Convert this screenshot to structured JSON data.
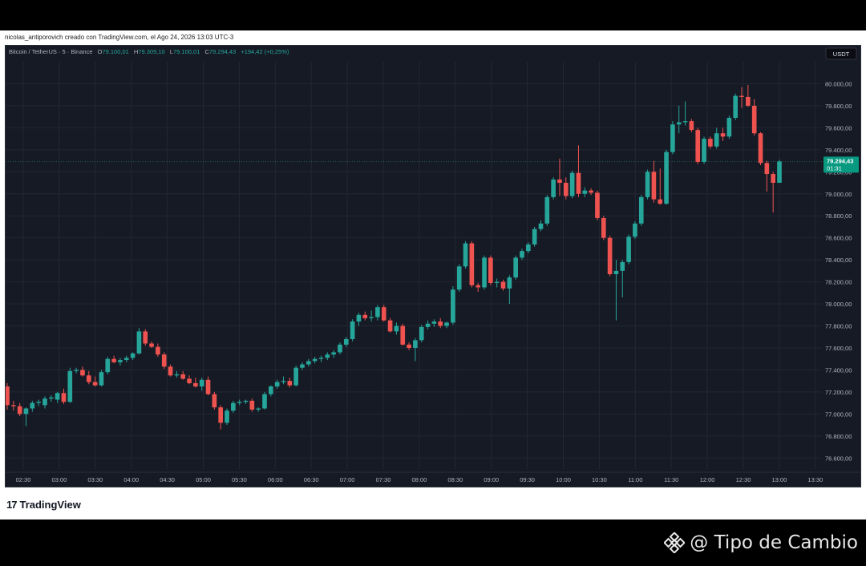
{
  "credit": "nicolas_antiporovich creado con TradingView.com, el Ago 24, 2026 13:03 UTC-3",
  "legend": {
    "symbol": "Bitcoin / TetherUS · 5 · Binance",
    "o_label": "O",
    "o_value": "79.100,01",
    "h_label": "H",
    "h_value": "79.309,10",
    "l_label": "L",
    "l_value": "79.100,01",
    "c_label": "C",
    "c_value": "79.294,43",
    "change": "+194,42 (+0,25%)"
  },
  "currency": "USDT",
  "price_tag": {
    "value": "79.294,43",
    "countdown": "01:31"
  },
  "brand": {
    "logo": "17",
    "name": "TradingView"
  },
  "watermark": {
    "icon": "binance-diamond-icon",
    "text": "@ Tipo de Cambio"
  },
  "colors": {
    "up": "#26a69a",
    "down": "#ef5350",
    "background": "#161a25",
    "grid": "#232733",
    "text": "#b2b5be"
  },
  "chart_data": {
    "type": "candlestick",
    "symbol": "Bitcoin / TetherUS",
    "interval": "5",
    "exchange": "Binance",
    "currency": "USDT",
    "ylim": [
      76500,
      80200
    ],
    "yticks": [
      76600,
      76800,
      77000,
      77200,
      77400,
      77600,
      77800,
      78000,
      78200,
      78400,
      78600,
      78800,
      79000,
      79200,
      79400,
      79600,
      79800,
      80000
    ],
    "ytick_labels": [
      "76.600,00",
      "76.800,00",
      "77.000,00",
      "77.200,00",
      "77.400,00",
      "77.600,00",
      "77.800,00",
      "78.000,00",
      "78.200,00",
      "78.400,00",
      "78.600,00",
      "78.800,00",
      "79.000,00",
      "79.200,00",
      "79.400,00",
      "79.600,00",
      "79.800,00",
      "80.000,00"
    ],
    "xtick_labels": [
      "02:30",
      "03:00",
      "03:30",
      "04:00",
      "04:30",
      "05:00",
      "05:30",
      "06:00",
      "06:30",
      "07:00",
      "07:30",
      "08:00",
      "08:30",
      "09:00",
      "09:30",
      "10:00",
      "10:30",
      "11:00",
      "11:30",
      "12:00",
      "12:30",
      "13:00",
      "13:30"
    ],
    "last_price": 79294.43,
    "candles": [
      {
        "o": 77250,
        "h": 77280,
        "l": 77040,
        "c": 77080
      },
      {
        "o": 77080,
        "h": 77120,
        "l": 77030,
        "c": 77070
      },
      {
        "o": 77070,
        "h": 77100,
        "l": 76980,
        "c": 77000
      },
      {
        "o": 77000,
        "h": 77060,
        "l": 76890,
        "c": 77050
      },
      {
        "o": 77050,
        "h": 77120,
        "l": 77020,
        "c": 77100
      },
      {
        "o": 77100,
        "h": 77130,
        "l": 77070,
        "c": 77110
      },
      {
        "o": 77080,
        "h": 77160,
        "l": 77050,
        "c": 77140
      },
      {
        "o": 77140,
        "h": 77170,
        "l": 77110,
        "c": 77150
      },
      {
        "o": 77130,
        "h": 77200,
        "l": 77100,
        "c": 77190
      },
      {
        "o": 77190,
        "h": 77230,
        "l": 77090,
        "c": 77110
      },
      {
        "o": 77110,
        "h": 77420,
        "l": 77100,
        "c": 77390
      },
      {
        "o": 77390,
        "h": 77420,
        "l": 77370,
        "c": 77400
      },
      {
        "o": 77400,
        "h": 77430,
        "l": 77340,
        "c": 77350
      },
      {
        "o": 77350,
        "h": 77390,
        "l": 77270,
        "c": 77290
      },
      {
        "o": 77290,
        "h": 77340,
        "l": 77250,
        "c": 77260
      },
      {
        "o": 77260,
        "h": 77400,
        "l": 77250,
        "c": 77380
      },
      {
        "o": 77380,
        "h": 77520,
        "l": 77360,
        "c": 77500
      },
      {
        "o": 77500,
        "h": 77530,
        "l": 77460,
        "c": 77470
      },
      {
        "o": 77470,
        "h": 77510,
        "l": 77440,
        "c": 77490
      },
      {
        "o": 77490,
        "h": 77530,
        "l": 77470,
        "c": 77510
      },
      {
        "o": 77510,
        "h": 77560,
        "l": 77490,
        "c": 77550
      },
      {
        "o": 77550,
        "h": 77780,
        "l": 77540,
        "c": 77750
      },
      {
        "o": 77750,
        "h": 77770,
        "l": 77620,
        "c": 77640
      },
      {
        "o": 77640,
        "h": 77660,
        "l": 77600,
        "c": 77610
      },
      {
        "o": 77610,
        "h": 77640,
        "l": 77520,
        "c": 77540
      },
      {
        "o": 77540,
        "h": 77560,
        "l": 77410,
        "c": 77430
      },
      {
        "o": 77430,
        "h": 77450,
        "l": 77340,
        "c": 77350
      },
      {
        "o": 77350,
        "h": 77390,
        "l": 77330,
        "c": 77360
      },
      {
        "o": 77360,
        "h": 77390,
        "l": 77310,
        "c": 77320
      },
      {
        "o": 77320,
        "h": 77350,
        "l": 77270,
        "c": 77280
      },
      {
        "o": 77280,
        "h": 77330,
        "l": 77240,
        "c": 77250
      },
      {
        "o": 77250,
        "h": 77330,
        "l": 77210,
        "c": 77310
      },
      {
        "o": 77310,
        "h": 77340,
        "l": 77170,
        "c": 77180
      },
      {
        "o": 77180,
        "h": 77200,
        "l": 77040,
        "c": 77060
      },
      {
        "o": 77060,
        "h": 77080,
        "l": 76860,
        "c": 76920
      },
      {
        "o": 76920,
        "h": 77050,
        "l": 76900,
        "c": 77030
      },
      {
        "o": 77030,
        "h": 77120,
        "l": 77010,
        "c": 77100
      },
      {
        "o": 77100,
        "h": 77130,
        "l": 77080,
        "c": 77110
      },
      {
        "o": 77110,
        "h": 77130,
        "l": 77090,
        "c": 77120
      },
      {
        "o": 77120,
        "h": 77140,
        "l": 77020,
        "c": 77040
      },
      {
        "o": 77040,
        "h": 77060,
        "l": 77020,
        "c": 77050
      },
      {
        "o": 77050,
        "h": 77200,
        "l": 77040,
        "c": 77180
      },
      {
        "o": 77180,
        "h": 77260,
        "l": 77160,
        "c": 77250
      },
      {
        "o": 77250,
        "h": 77310,
        "l": 77230,
        "c": 77290
      },
      {
        "o": 77290,
        "h": 77340,
        "l": 77270,
        "c": 77300
      },
      {
        "o": 77300,
        "h": 77330,
        "l": 77240,
        "c": 77260
      },
      {
        "o": 77260,
        "h": 77440,
        "l": 77250,
        "c": 77420
      },
      {
        "o": 77420,
        "h": 77470,
        "l": 77400,
        "c": 77450
      },
      {
        "o": 77450,
        "h": 77500,
        "l": 77430,
        "c": 77480
      },
      {
        "o": 77480,
        "h": 77520,
        "l": 77460,
        "c": 77500
      },
      {
        "o": 77500,
        "h": 77530,
        "l": 77470,
        "c": 77510
      },
      {
        "o": 77510,
        "h": 77560,
        "l": 77490,
        "c": 77540
      },
      {
        "o": 77540,
        "h": 77580,
        "l": 77510,
        "c": 77560
      },
      {
        "o": 77560,
        "h": 77650,
        "l": 77540,
        "c": 77630
      },
      {
        "o": 77630,
        "h": 77700,
        "l": 77610,
        "c": 77680
      },
      {
        "o": 77680,
        "h": 77860,
        "l": 77660,
        "c": 77840
      },
      {
        "o": 77840,
        "h": 77920,
        "l": 77800,
        "c": 77900
      },
      {
        "o": 77900,
        "h": 77930,
        "l": 77850,
        "c": 77870
      },
      {
        "o": 77870,
        "h": 77940,
        "l": 77840,
        "c": 77880
      },
      {
        "o": 77880,
        "h": 77990,
        "l": 77850,
        "c": 77970
      },
      {
        "o": 77970,
        "h": 77990,
        "l": 77840,
        "c": 77850
      },
      {
        "o": 77850,
        "h": 77870,
        "l": 77740,
        "c": 77750
      },
      {
        "o": 77750,
        "h": 77830,
        "l": 77720,
        "c": 77800
      },
      {
        "o": 77800,
        "h": 77820,
        "l": 77620,
        "c": 77630
      },
      {
        "o": 77630,
        "h": 77650,
        "l": 77580,
        "c": 77600
      },
      {
        "o": 77600,
        "h": 77690,
        "l": 77480,
        "c": 77670
      },
      {
        "o": 77670,
        "h": 77810,
        "l": 77650,
        "c": 77790
      },
      {
        "o": 77790,
        "h": 77850,
        "l": 77770,
        "c": 77820
      },
      {
        "o": 77820,
        "h": 77860,
        "l": 77790,
        "c": 77840
      },
      {
        "o": 77840,
        "h": 77870,
        "l": 77780,
        "c": 77800
      },
      {
        "o": 77800,
        "h": 77840,
        "l": 77780,
        "c": 77830
      },
      {
        "o": 77830,
        "h": 78160,
        "l": 77810,
        "c": 78130
      },
      {
        "o": 78130,
        "h": 78360,
        "l": 78110,
        "c": 78340
      },
      {
        "o": 78340,
        "h": 78570,
        "l": 78320,
        "c": 78550
      },
      {
        "o": 78550,
        "h": 78570,
        "l": 78150,
        "c": 78170
      },
      {
        "o": 78170,
        "h": 78190,
        "l": 78110,
        "c": 78150
      },
      {
        "o": 78150,
        "h": 78440,
        "l": 78130,
        "c": 78420
      },
      {
        "o": 78420,
        "h": 78440,
        "l": 78170,
        "c": 78190
      },
      {
        "o": 78190,
        "h": 78230,
        "l": 78150,
        "c": 78200
      },
      {
        "o": 78200,
        "h": 78220,
        "l": 78120,
        "c": 78140
      },
      {
        "o": 78140,
        "h": 78260,
        "l": 78000,
        "c": 78240
      },
      {
        "o": 78240,
        "h": 78440,
        "l": 78220,
        "c": 78420
      },
      {
        "o": 78420,
        "h": 78500,
        "l": 78400,
        "c": 78480
      },
      {
        "o": 78480,
        "h": 78560,
        "l": 78460,
        "c": 78540
      },
      {
        "o": 78540,
        "h": 78700,
        "l": 78520,
        "c": 78680
      },
      {
        "o": 78680,
        "h": 78760,
        "l": 78660,
        "c": 78730
      },
      {
        "o": 78730,
        "h": 78990,
        "l": 78710,
        "c": 78970
      },
      {
        "o": 78970,
        "h": 79150,
        "l": 78950,
        "c": 79130
      },
      {
        "o": 79130,
        "h": 79320,
        "l": 78980,
        "c": 79100
      },
      {
        "o": 79100,
        "h": 79150,
        "l": 78950,
        "c": 78980
      },
      {
        "o": 78980,
        "h": 79210,
        "l": 78960,
        "c": 79190
      },
      {
        "o": 79190,
        "h": 79440,
        "l": 78970,
        "c": 79000
      },
      {
        "o": 79000,
        "h": 79060,
        "l": 78970,
        "c": 79030
      },
      {
        "o": 79030,
        "h": 79050,
        "l": 78990,
        "c": 79010
      },
      {
        "o": 79010,
        "h": 79030,
        "l": 78760,
        "c": 78780
      },
      {
        "o": 78780,
        "h": 78800,
        "l": 78580,
        "c": 78600
      },
      {
        "o": 78600,
        "h": 78620,
        "l": 78250,
        "c": 78270
      },
      {
        "o": 78270,
        "h": 78400,
        "l": 77850,
        "c": 78300
      },
      {
        "o": 78300,
        "h": 78400,
        "l": 78060,
        "c": 78380
      },
      {
        "o": 78380,
        "h": 78630,
        "l": 78360,
        "c": 78610
      },
      {
        "o": 78610,
        "h": 78750,
        "l": 78590,
        "c": 78730
      },
      {
        "o": 78730,
        "h": 78990,
        "l": 78710,
        "c": 78970
      },
      {
        "o": 78970,
        "h": 79220,
        "l": 78950,
        "c": 79200
      },
      {
        "o": 79200,
        "h": 79300,
        "l": 78920,
        "c": 78950
      },
      {
        "o": 78950,
        "h": 79230,
        "l": 78900,
        "c": 78910
      },
      {
        "o": 78910,
        "h": 79400,
        "l": 78900,
        "c": 79380
      },
      {
        "o": 79380,
        "h": 79660,
        "l": 79360,
        "c": 79630
      },
      {
        "o": 79630,
        "h": 79800,
        "l": 79550,
        "c": 79650
      },
      {
        "o": 79650,
        "h": 79840,
        "l": 79620,
        "c": 79660
      },
      {
        "o": 79660,
        "h": 79680,
        "l": 79560,
        "c": 79580
      },
      {
        "o": 79580,
        "h": 79600,
        "l": 79270,
        "c": 79290
      },
      {
        "o": 79290,
        "h": 79520,
        "l": 79270,
        "c": 79500
      },
      {
        "o": 79500,
        "h": 79520,
        "l": 79410,
        "c": 79430
      },
      {
        "o": 79430,
        "h": 79600,
        "l": 79410,
        "c": 79550
      },
      {
        "o": 79550,
        "h": 79600,
        "l": 79480,
        "c": 79520
      },
      {
        "o": 79520,
        "h": 79710,
        "l": 79500,
        "c": 79690
      },
      {
        "o": 79690,
        "h": 79910,
        "l": 79670,
        "c": 79890
      },
      {
        "o": 79890,
        "h": 79970,
        "l": 79780,
        "c": 79880
      },
      {
        "o": 79880,
        "h": 79990,
        "l": 79790,
        "c": 79800
      },
      {
        "o": 79800,
        "h": 79860,
        "l": 79530,
        "c": 79550
      },
      {
        "o": 79550,
        "h": 79560,
        "l": 79260,
        "c": 79280
      },
      {
        "o": 79280,
        "h": 79300,
        "l": 79020,
        "c": 79180
      },
      {
        "o": 79180,
        "h": 79200,
        "l": 78830,
        "c": 79100
      },
      {
        "o": 79100,
        "h": 79309,
        "l": 79100,
        "c": 79294
      }
    ]
  }
}
